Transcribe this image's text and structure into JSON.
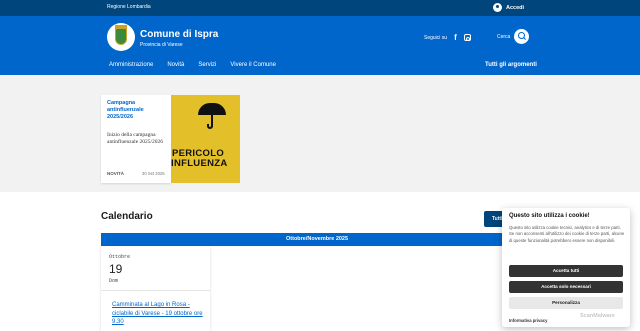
{
  "slim_header": {
    "region": "Regione Lombardia",
    "login_label": "Accedi",
    "login_icon": "user-icon"
  },
  "header": {
    "title": "Comune di Ispra",
    "subtitle": "Provincia di Varese",
    "social_label": "Seguici su",
    "social_icons": [
      "facebook-icon",
      "instagram-icon"
    ],
    "search_label": "Cerca",
    "search_icon": "search-icon",
    "colors": {
      "primary": "#0066cc",
      "dark": "#00457c"
    }
  },
  "nav": {
    "items": [
      "Amministrazione",
      "Novità",
      "Servizi",
      "Vivere il Comune"
    ],
    "all_topics": "Tutti gli argomenti"
  },
  "news_card": {
    "title": "Campagna antinfluenzale 2025/2026",
    "text": "Inizio della campagna antinfluenzale 2025/2026",
    "tag": "NOVITÀ",
    "date": "30 Set 2025",
    "image_word1": "PERICOLO",
    "image_word2": "INFLUENZA"
  },
  "calendar": {
    "title": "Calendario",
    "button_label": "Tutti",
    "period": "Ottobre/Novembre 2025",
    "day": {
      "month": "Ottobre",
      "number": "19",
      "weekday": "Dom",
      "event": "Camminata al Lago in Rosa - ciclabile di Varese - 19 ottobre ore 9.30"
    }
  },
  "cookie": {
    "title": "Questo sito utilizza i cookie!",
    "text": "Questo sito utilizza cookie tecnici, analytics e di terze parti. Se non acconsenti all'utilizzo dei cookie di terze parti, alcune di queste funzionalità potrebbero essere non disponibili.",
    "accept_all": "Accetta tutti",
    "accept_necessary": "Accetta solo necessari",
    "customize": "Personalizza",
    "privacy": "Informativa privacy",
    "watermark": "ScanMalware"
  }
}
